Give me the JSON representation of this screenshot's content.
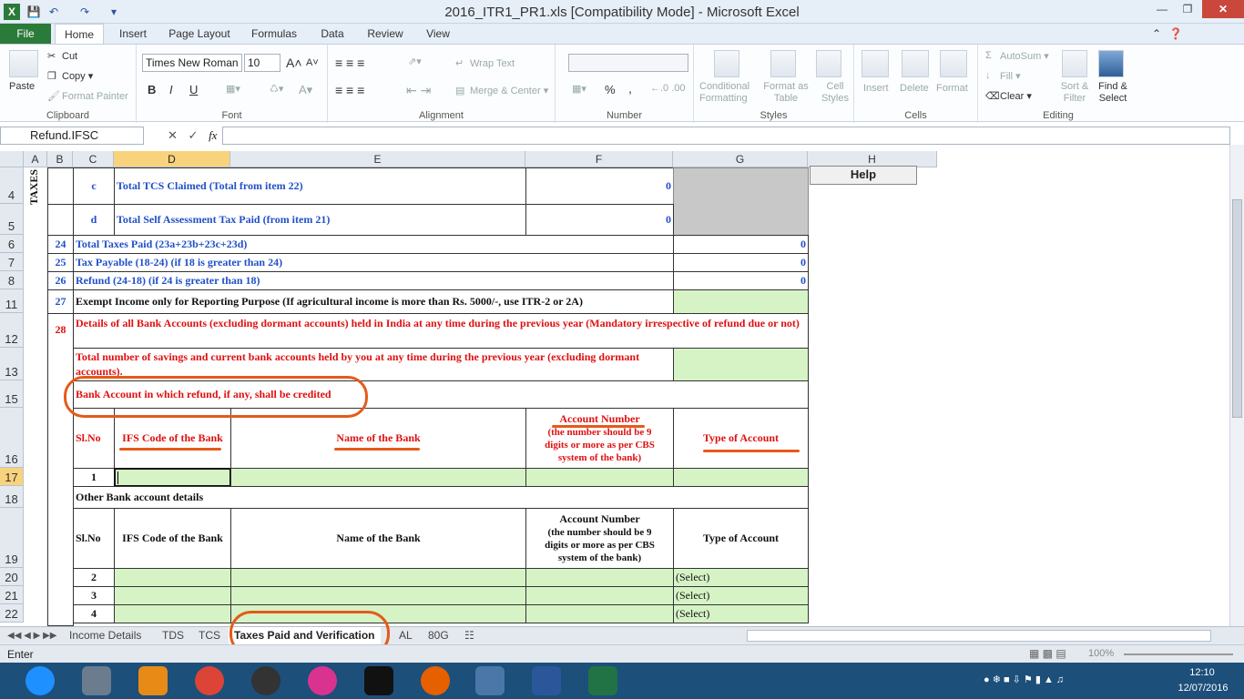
{
  "window": {
    "title": "2016_ITR1_PR1.xls  [Compatibility Mode]  -  Microsoft Excel"
  },
  "ribbon_tabs": [
    "File",
    "Home",
    "Insert",
    "Page Layout",
    "Formulas",
    "Data",
    "Review",
    "View"
  ],
  "ribbon": {
    "clipboard": {
      "label": "Clipboard",
      "paste": "Paste",
      "cut": "Cut",
      "copy": "Copy",
      "format_painter": "Format Painter"
    },
    "font": {
      "label": "Font",
      "name": "Times New Roman",
      "size": "10",
      "bold": "B",
      "italic": "I",
      "underline": "U"
    },
    "alignment": {
      "label": "Alignment",
      "wrap": "Wrap Text",
      "merge": "Merge & Center"
    },
    "number": {
      "label": "Number",
      "percent": "%",
      "comma": ","
    },
    "styles": {
      "label": "Styles",
      "conditional": "Conditional Formatting",
      "format_table": "Format as Table",
      "cell_styles": "Cell Styles"
    },
    "cells": {
      "label": "Cells",
      "insert": "Insert",
      "delete": "Delete",
      "format": "Format"
    },
    "editing": {
      "label": "Editing",
      "autosum": "AutoSum",
      "fill": "Fill",
      "clear": "Clear",
      "sort": "Sort & Filter",
      "find": "Find & Select"
    }
  },
  "formula_bar": {
    "name_box": "Refund.IFSC",
    "fx": "fx",
    "formula": ""
  },
  "columns": [
    "A",
    "B",
    "C",
    "D",
    "E",
    "F",
    "G",
    "H"
  ],
  "rows": [
    "4",
    "5",
    "6",
    "7",
    "8",
    "11",
    "12",
    "13",
    "15",
    "16",
    "17",
    "18",
    "19",
    "20",
    "21",
    "22"
  ],
  "sheet": {
    "taxes": "TAXES",
    "help": "Help",
    "c_letter": "c",
    "c_label": "Total TCS Claimed (Total from item 22)",
    "c_value": "0",
    "d_letter": "d",
    "d_label": "Total Self Assessment Tax Paid (from item 21)",
    "d_value": "0",
    "r24_no": "24",
    "r24_label": "Total Taxes Paid (23a+23b+23c+23d)",
    "r24_value": "0",
    "r25_no": "25",
    "r25_label": "Tax Payable (18-24) (if 18 is greater than 24)",
    "r25_value": "0",
    "r26_no": "26",
    "r26_label": "Refund (24-18) (if 24 is greater than 18)",
    "r26_value": "0",
    "r27_no": "27",
    "r27_label": "Exempt Income only for Reporting Purpose (If agricultural income is more than Rs. 5000/-, use ITR-2 or 2A)",
    "r28_no": "28",
    "r28_label": "Details of all Bank Accounts (excluding dormant accounts) held in India at any time during the previous year  (Mandatory irrespective of refund due or not)",
    "r13_label": "Total number of savings and current bank accounts held by you at any time during the previous year (excluding dormant accounts).",
    "r15_label": "Bank Account in which refund, if any, shall be credited",
    "hdr_slno": "Sl.No",
    "hdr_ifsc": "IFS Code of the Bank",
    "hdr_bank": "Name of the Bank",
    "hdr_acct": "Account Number",
    "hdr_acct_note": "(the number should be 9 digits or more as per CBS system of the bank)",
    "hdr_type": "Type of Account",
    "row17_no": "1",
    "r18_label": "Other Bank account details",
    "row20_no": "2",
    "row21_no": "3",
    "row22_no": "4",
    "select": "(Select)"
  },
  "sheet_tabs": [
    "Income Details",
    "TDS",
    "TCS",
    "Taxes Paid and Verification",
    "AL",
    "80G"
  ],
  "status": {
    "mode": "Enter",
    "zoom": "100%"
  },
  "taskbar": {
    "time": "12:10",
    "date": "12/07/2016"
  }
}
